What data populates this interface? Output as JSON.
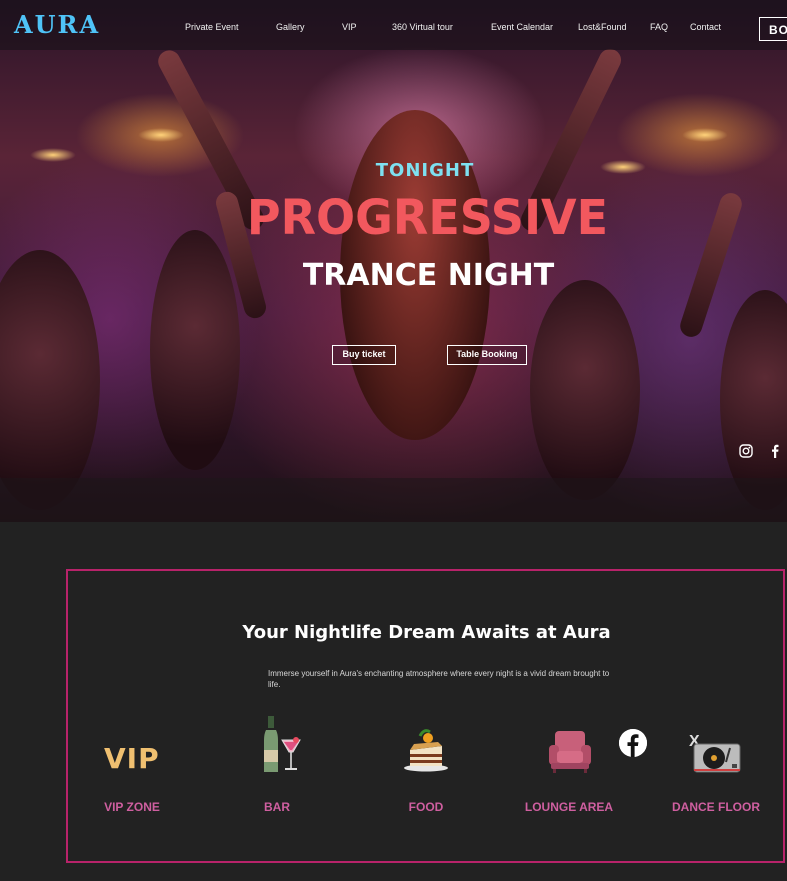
{
  "header": {
    "logo": "AURA",
    "nav": [
      {
        "label": "Private Event"
      },
      {
        "label": "Gallery"
      },
      {
        "label": "VIP"
      },
      {
        "label": "360 Virtual tour"
      },
      {
        "label": "Event Calendar"
      },
      {
        "label": "Lost&Found"
      },
      {
        "label": "FAQ"
      },
      {
        "label": "Contact"
      }
    ],
    "book_label": "BO"
  },
  "hero": {
    "kicker": "TONIGHT",
    "headline": "PROGRESSIVE",
    "subheadline": "TRANCE NIGHT",
    "buy_ticket": "Buy ticket",
    "table_booking": "Table Booking",
    "social": [
      "instagram-icon",
      "facebook-icon"
    ]
  },
  "features": {
    "title": "Your Nightlife Dream Awaits at Aura",
    "description": "Immerse yourself in Aura's enchanting atmosphere where every night is a vivid dream brought to life.",
    "items": [
      {
        "label": "VIP ZONE",
        "icon_text": "VIP",
        "icon": "vip-icon"
      },
      {
        "label": "BAR",
        "icon": "drinks-icon"
      },
      {
        "label": "FOOD",
        "icon": "cake-icon"
      },
      {
        "label": "LOUNGE AREA",
        "icon": "sofa-icon"
      },
      {
        "label": "DANCE FLOOR",
        "icon": "turntable-icon"
      }
    ],
    "overlay_icons": [
      "facebook-icon",
      "x-icon"
    ],
    "x_glyph": "X"
  },
  "colors": {
    "logo": "#4fc3f7",
    "kicker": "#7ee0f0",
    "headline": "#f2585e",
    "accent_border": "#b8236a",
    "feature_label": "#cf5fa0",
    "background": "#222222"
  }
}
